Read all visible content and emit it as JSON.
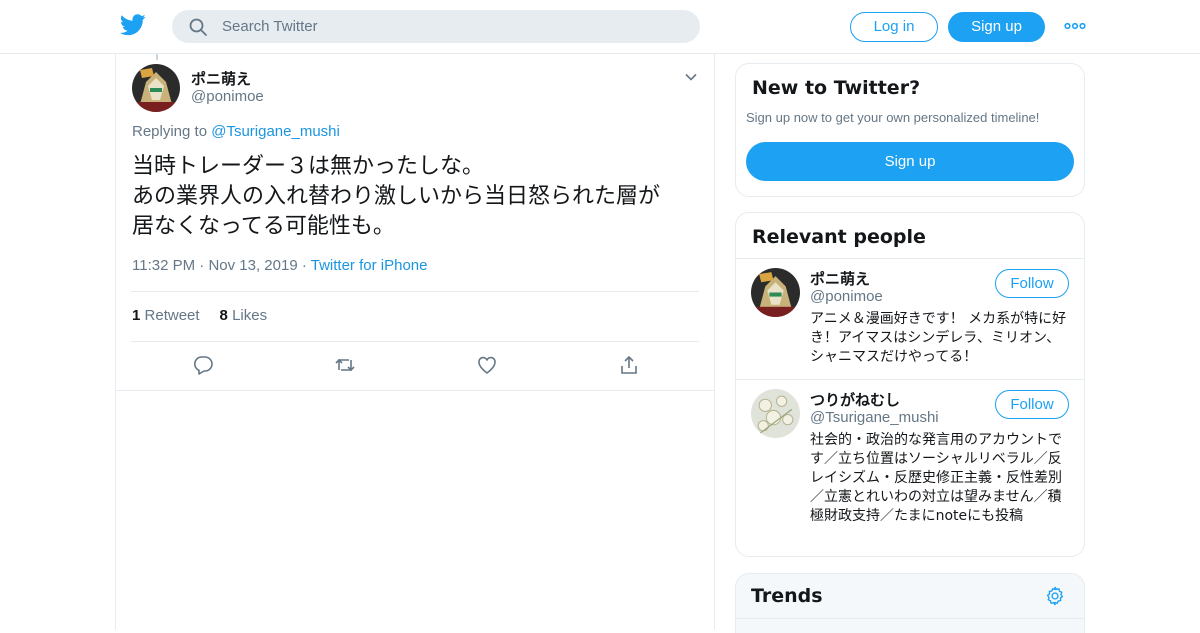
{
  "header": {
    "search_placeholder": "Search Twitter",
    "login_label": "Log in",
    "signup_label": "Sign up",
    "accent_color": "#1da1f2"
  },
  "tweet": {
    "author_name": "ポニ萌え",
    "author_handle": "@ponimoe",
    "replying_prefix": "Replying to",
    "replying_to": "@Tsurigane_mushi",
    "text_lines": [
      "当時トレーダー３は無かったしな。",
      "あの業界人の入れ替わり激しいから当日怒られた層が",
      "居なくなってる可能性も。"
    ],
    "time": "11:32 PM",
    "date": "Nov 13, 2019",
    "source": "Twitter for iPhone",
    "retweet_count": "1",
    "retweet_label": "Retweet",
    "like_count": "8",
    "like_label": "Likes"
  },
  "sidebar": {
    "new_title": "New to Twitter?",
    "new_subtitle": "Sign up now to get your own personalized timeline!",
    "new_signup_label": "Sign up",
    "relevant_title": "Relevant people",
    "people": [
      {
        "name": "ポニ萌え",
        "handle": "@ponimoe",
        "follow_label": "Follow",
        "bio": "アニメ＆漫画好きです！ メカ系が特に好き！アイマスはシンデレラ、ミリオン、シャニマスだけやってる！"
      },
      {
        "name": "つりがねむし",
        "handle": "@Tsurigane_mushi",
        "follow_label": "Follow",
        "bio": "社会的・政治的な発言用のアカウントです／立ち位置はソーシャルリベラル／反レイシズム・反歴史修正主義・反性差別／立憲とれいわの対立は望みません／積極財政支持／たまにnoteにも投稿"
      }
    ],
    "trends_title": "Trends"
  }
}
